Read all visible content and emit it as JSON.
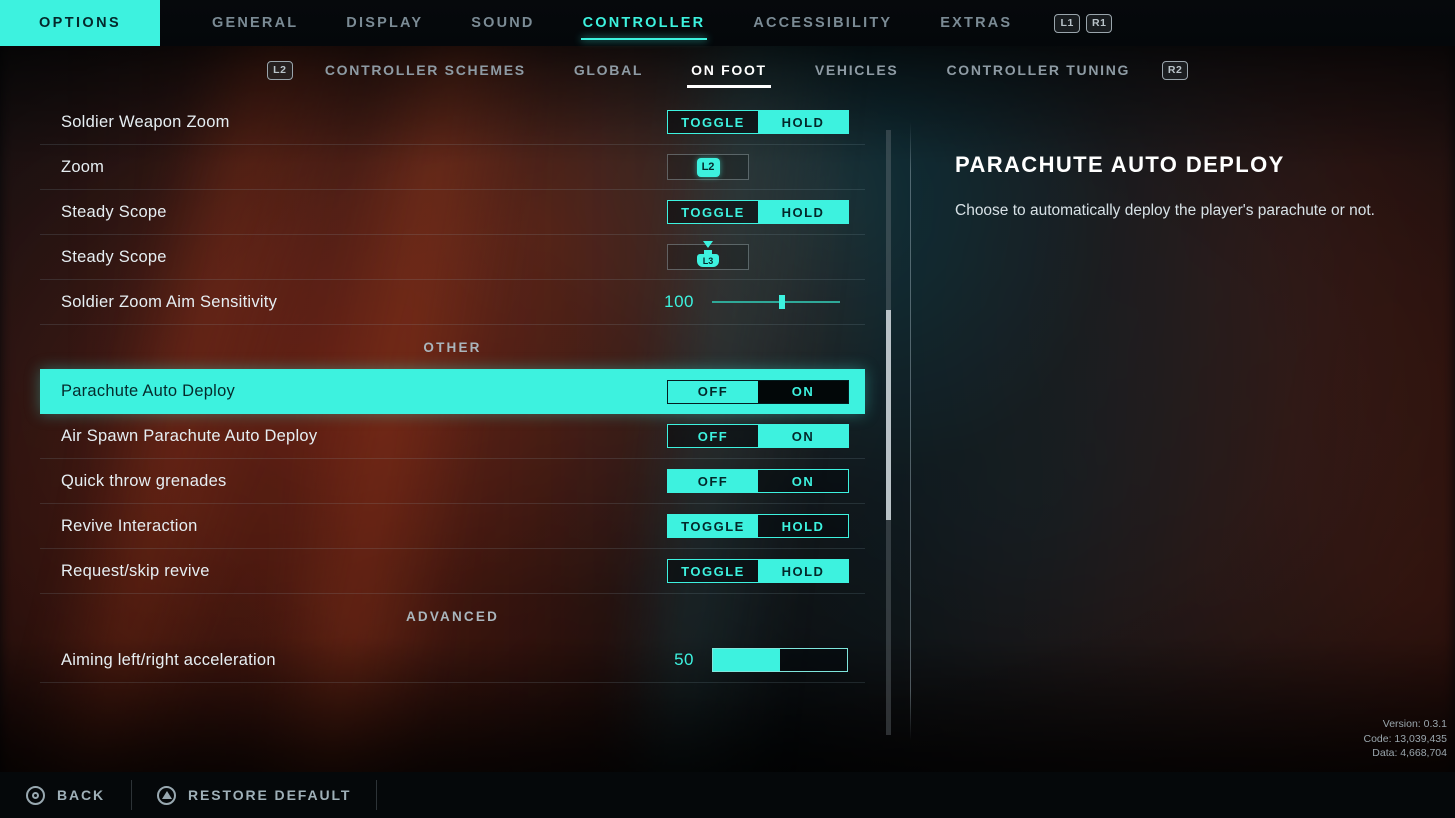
{
  "header": {
    "options_label": "OPTIONS",
    "tabs": [
      {
        "label": "GENERAL",
        "active": false
      },
      {
        "label": "DISPLAY",
        "active": false
      },
      {
        "label": "SOUND",
        "active": false
      },
      {
        "label": "CONTROLLER",
        "active": true
      },
      {
        "label": "ACCESSIBILITY",
        "active": false
      },
      {
        "label": "EXTRAS",
        "active": false
      }
    ],
    "badges": [
      "L1",
      "R1"
    ],
    "accent_color": "#3df2df"
  },
  "subnav": {
    "left_badge": "L2",
    "right_badge": "R2",
    "tabs": [
      {
        "label": "CONTROLLER SCHEMES",
        "active": false
      },
      {
        "label": "GLOBAL",
        "active": false
      },
      {
        "label": "ON FOOT",
        "active": true
      },
      {
        "label": "VEHICLES",
        "active": false
      },
      {
        "label": "CONTROLLER TUNING",
        "active": false
      }
    ]
  },
  "rows": [
    {
      "type": "setting",
      "label": "Soldier Weapon Zoom",
      "control": "segment",
      "options": [
        "TOGGLE",
        "HOLD"
      ],
      "selected": "HOLD",
      "highlighted": false
    },
    {
      "type": "setting",
      "label": "Zoom",
      "control": "bind",
      "key": "L2",
      "highlighted": false
    },
    {
      "type": "setting",
      "label": "Steady Scope",
      "control": "segment",
      "options": [
        "TOGGLE",
        "HOLD"
      ],
      "selected": "HOLD",
      "highlighted": false
    },
    {
      "type": "setting",
      "label": "Steady Scope",
      "control": "stick",
      "key": "L3",
      "highlighted": false
    },
    {
      "type": "setting",
      "label": "Soldier Zoom Aim Sensitivity",
      "control": "line-slider",
      "value": "100",
      "percent": 55,
      "highlighted": false
    },
    {
      "type": "section",
      "label": "OTHER"
    },
    {
      "type": "setting",
      "label": "Parachute Auto Deploy",
      "control": "segment",
      "options": [
        "OFF",
        "ON"
      ],
      "selected": "OFF",
      "highlighted": true
    },
    {
      "type": "setting",
      "label": "Air Spawn Parachute Auto Deploy",
      "control": "segment",
      "options": [
        "OFF",
        "ON"
      ],
      "selected": "ON",
      "highlighted": false
    },
    {
      "type": "setting",
      "label": "Quick throw grenades",
      "control": "segment",
      "options": [
        "OFF",
        "ON"
      ],
      "selected": "OFF",
      "highlighted": false
    },
    {
      "type": "setting",
      "label": "Revive Interaction",
      "control": "segment",
      "options": [
        "TOGGLE",
        "HOLD"
      ],
      "selected": "TOGGLE",
      "highlighted": false
    },
    {
      "type": "setting",
      "label": "Request/skip revive",
      "control": "segment",
      "options": [
        "TOGGLE",
        "HOLD"
      ],
      "selected": "HOLD",
      "highlighted": false
    },
    {
      "type": "section",
      "label": "ADVANCED"
    },
    {
      "type": "setting",
      "label": "Aiming left/right acceleration",
      "control": "bar-slider",
      "value": "50",
      "percent": 50,
      "highlighted": false
    }
  ],
  "description": {
    "title": "PARACHUTE AUTO DEPLOY",
    "body": "Choose to automatically deploy the player's parachute or not."
  },
  "version_info": {
    "version": "Version: 0.3.1",
    "code": "Code: 13,039,435",
    "data": "Data: 4,668,704"
  },
  "footer": {
    "buttons": [
      {
        "label": "BACK",
        "icon": "circle-icon"
      },
      {
        "label": "RESTORE DEFAULT",
        "icon": "triangle-icon"
      }
    ]
  }
}
